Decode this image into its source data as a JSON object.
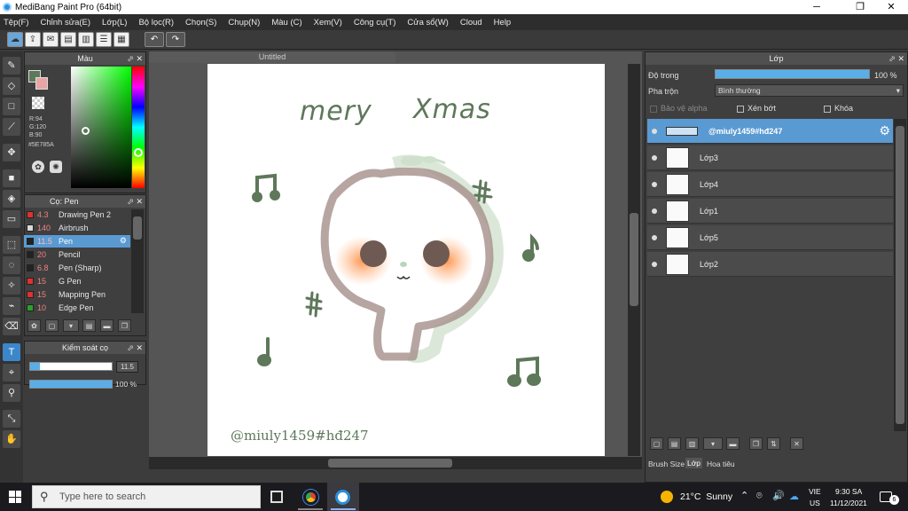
{
  "window": {
    "title": "MediBang Paint Pro (64bit)",
    "minimize": "─",
    "maximize": "❐",
    "close": "✕"
  },
  "menu": [
    "Tệp(F)",
    "Chỉnh sửa(E)",
    "Lớp(L)",
    "Bộ lọc(R)",
    "Chọn(S)",
    "Chụp(N)",
    "Màu (C)",
    "Xem(V)",
    "Công cụ(T)",
    "Cửa sổ(W)",
    "Cloud",
    "Help"
  ],
  "color_panel": {
    "title": "Màu",
    "r": "R:94",
    "g": "G:120",
    "b": "B:90",
    "hex": "#5E785A",
    "current_color": "#5e785a"
  },
  "brush_panel": {
    "title": "Cọ: Pen",
    "items": [
      {
        "size": "4.3",
        "name": "Drawing Pen 2",
        "color": "#e03030"
      },
      {
        "size": "140",
        "name": "Airbrush",
        "color": "#d8d8d8"
      },
      {
        "size": "11.5",
        "name": "Pen",
        "color": "#222222"
      },
      {
        "size": "20",
        "name": "Pencil",
        "color": "#222222"
      },
      {
        "size": "6.8",
        "name": "Pen (Sharp)",
        "color": "#222222"
      },
      {
        "size": "15",
        "name": "G Pen",
        "color": "#e03030"
      },
      {
        "size": "15",
        "name": "Mapping Pen",
        "color": "#e03030"
      },
      {
        "size": "10",
        "name": "Edge Pen",
        "color": "#2aa02a"
      }
    ]
  },
  "brush_control": {
    "title": "Kiểm soát cọ",
    "size_value": "11.5",
    "opacity_value": "100 %",
    "size_level": 0.12,
    "opacity_level": 1.0
  },
  "canvas": {
    "tab": "Untitled",
    "text_mery": "mery",
    "text_xmas": "Xmas",
    "signature": "@miuly1459#hđ247",
    "stroke_color": "#5e785a"
  },
  "layer_panel": {
    "title": "Lớp",
    "opacity_label": "Độ trong",
    "opacity_value": "100 %",
    "opacity_level": 1.0,
    "blend_label": "Pha trộn",
    "blend_value": "Bình thường",
    "alpha_label": "Bảo vệ alpha",
    "clip_label": "Xén bớt",
    "lock_label": "Khóa",
    "layers": [
      "@miuly1459#hđ247",
      "Lớp3",
      "Lớp4",
      "Lớp1",
      "Lớp5",
      "Lớp2"
    ]
  },
  "bottom_tabs": [
    "Brush Size",
    "Lớp",
    "Hoa tiêu"
  ],
  "taskbar": {
    "search_placeholder": "Type here to search",
    "weather": "21°C  Sunny",
    "lang_top": "VIE",
    "lang_bottom": "US",
    "time": "9:30 SA",
    "date": "11/12/2021",
    "notifications": "6"
  }
}
